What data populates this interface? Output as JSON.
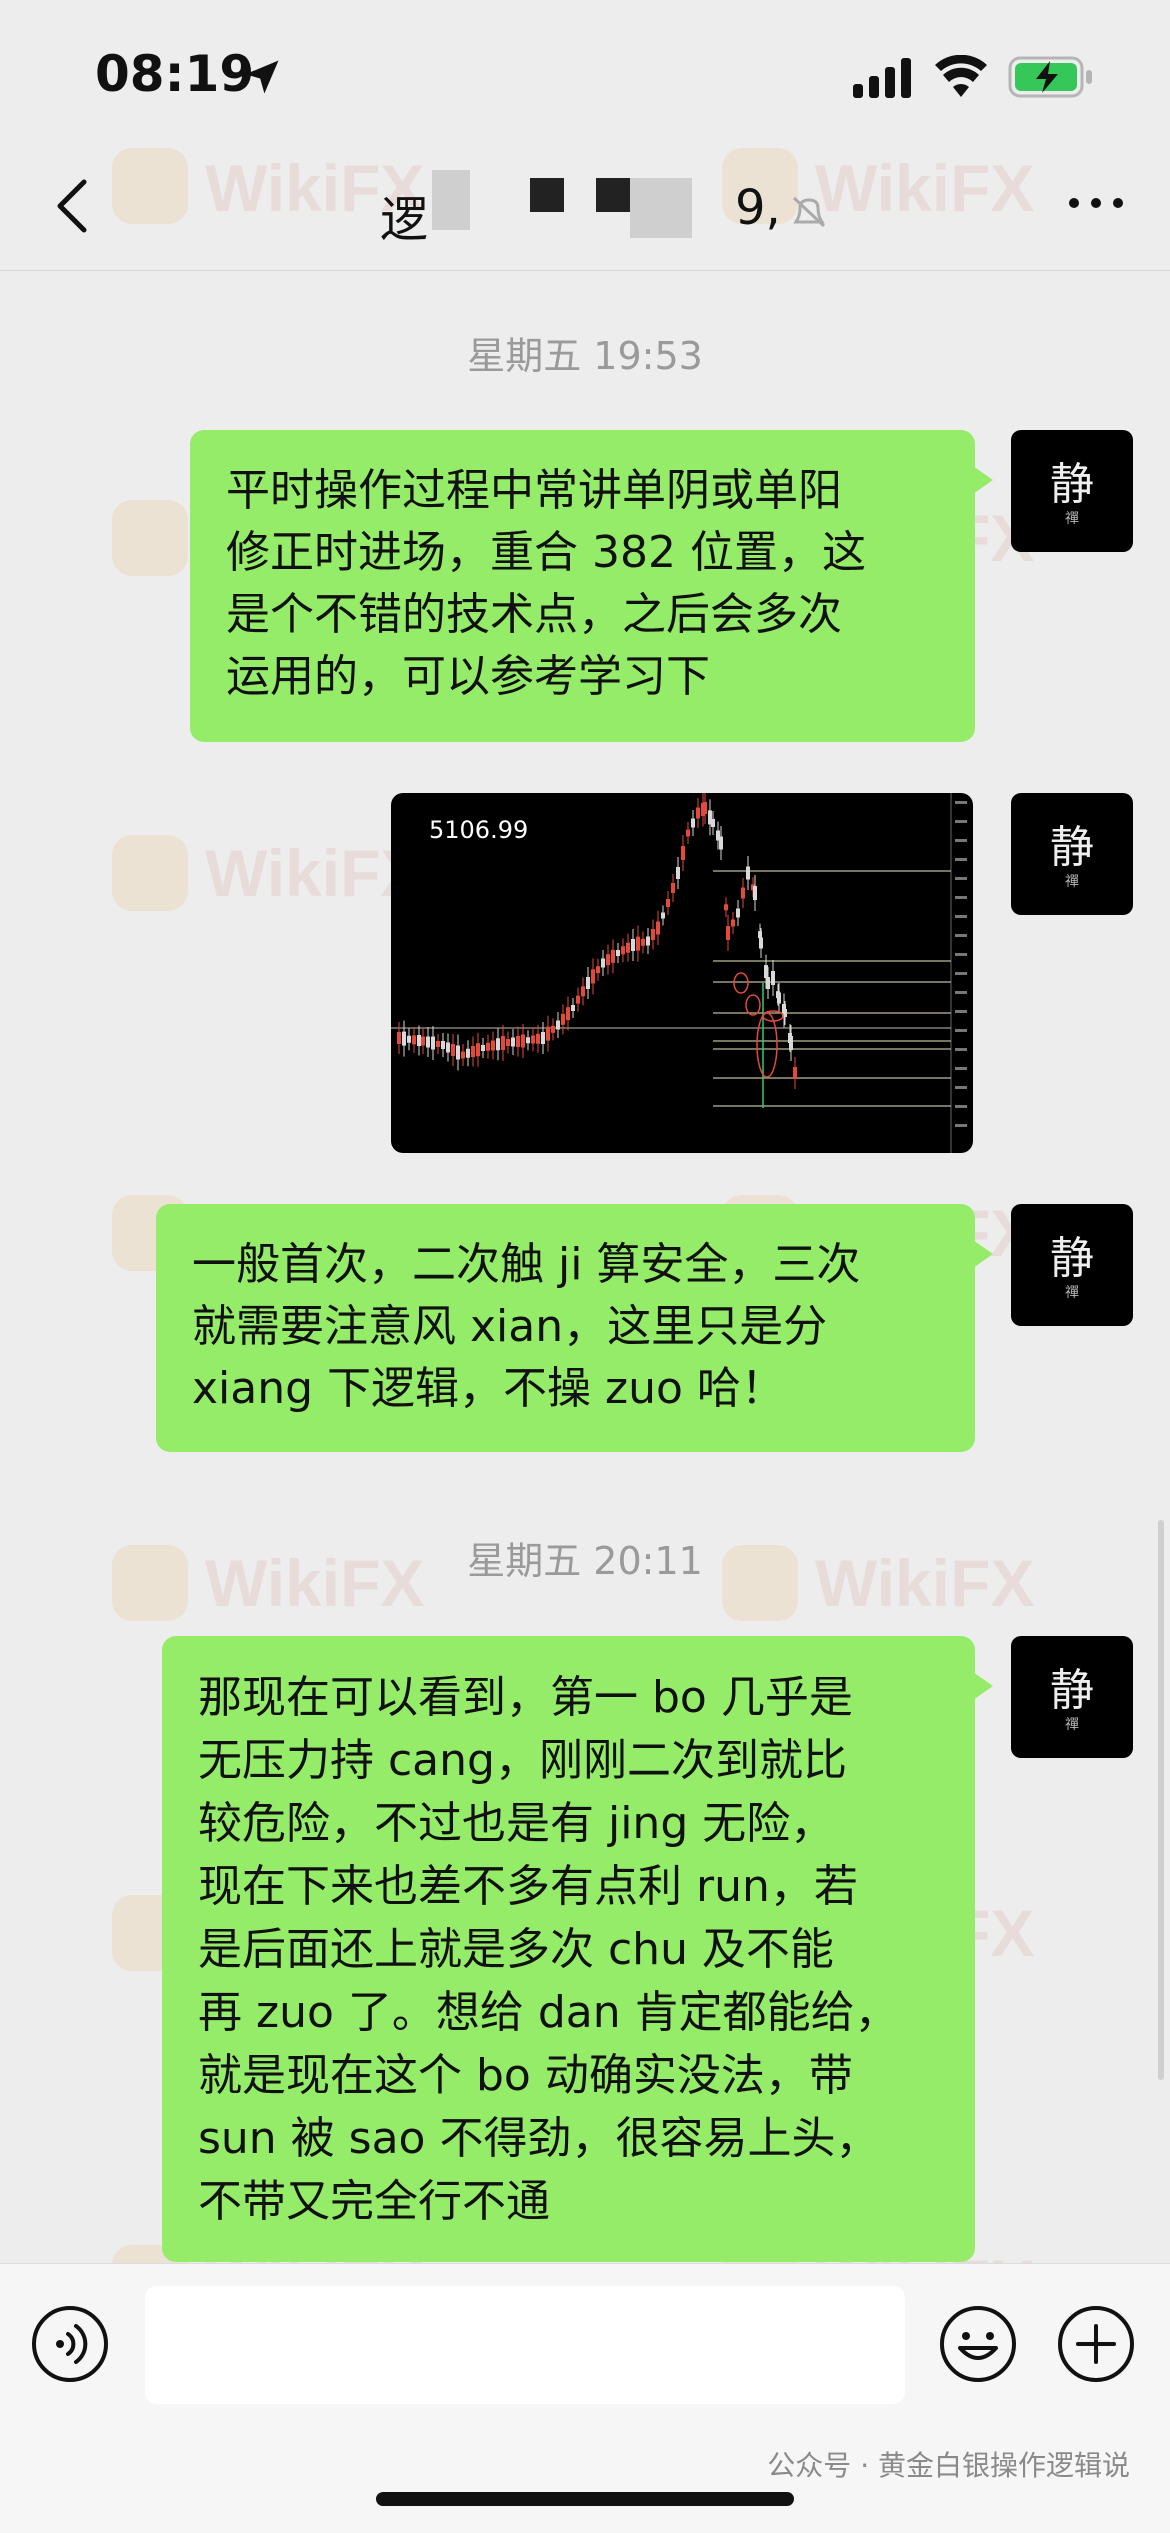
{
  "status_bar": {
    "time": "08:19",
    "battery_charging": true
  },
  "header": {
    "title": "逻",
    "title_tail": "9,",
    "back_icon": "chevron-left-icon",
    "more_icon": "ellipsis-icon"
  },
  "separators": [
    "星期五 19:53",
    "星期五 20:11"
  ],
  "avatar": {
    "glyph": "静",
    "sub": "禪"
  },
  "messages": [
    {
      "type": "text",
      "text": "平时操作过程中常讲单阴或单阳\n修正时进场，重合 382 位置，这\n是个不错的技术点，之后会多次\n运用的，可以参考学习下"
    },
    {
      "type": "image",
      "chart_label": "5106.99"
    },
    {
      "type": "text",
      "text": "一般首次，二次触 ji 算安全，三次\n就需要注意风 xian，这里只是分\nxiang 下逻辑，不操 zuo 哈！"
    },
    {
      "type": "text",
      "text": "那现在可以看到，第一 bo 几乎是\n无压力持 cang，刚刚二次到就比\n较危险，不过也是有 jing 无险，\n现在下来也差不多有点利 run，若\n是后面还上就是多次 chu 及不能\n再 zuo 了。想给 dan 肯定都能给，\n就是现在这个 bo 动确实没法，带\nsun 被 sao 不得劲，很容易上头，\n不带又完全行不通"
    }
  ],
  "input_bar": {
    "voice_icon": "voice-icon",
    "emoji_icon": "emoji-icon",
    "plus_icon": "plus-icon"
  },
  "footer": {
    "credit": "公众号 · 黄金白银操作逻辑说"
  },
  "watermark": {
    "text": "WikiFX"
  },
  "colors": {
    "bubble": "#95ec69",
    "background": "#ededed"
  }
}
